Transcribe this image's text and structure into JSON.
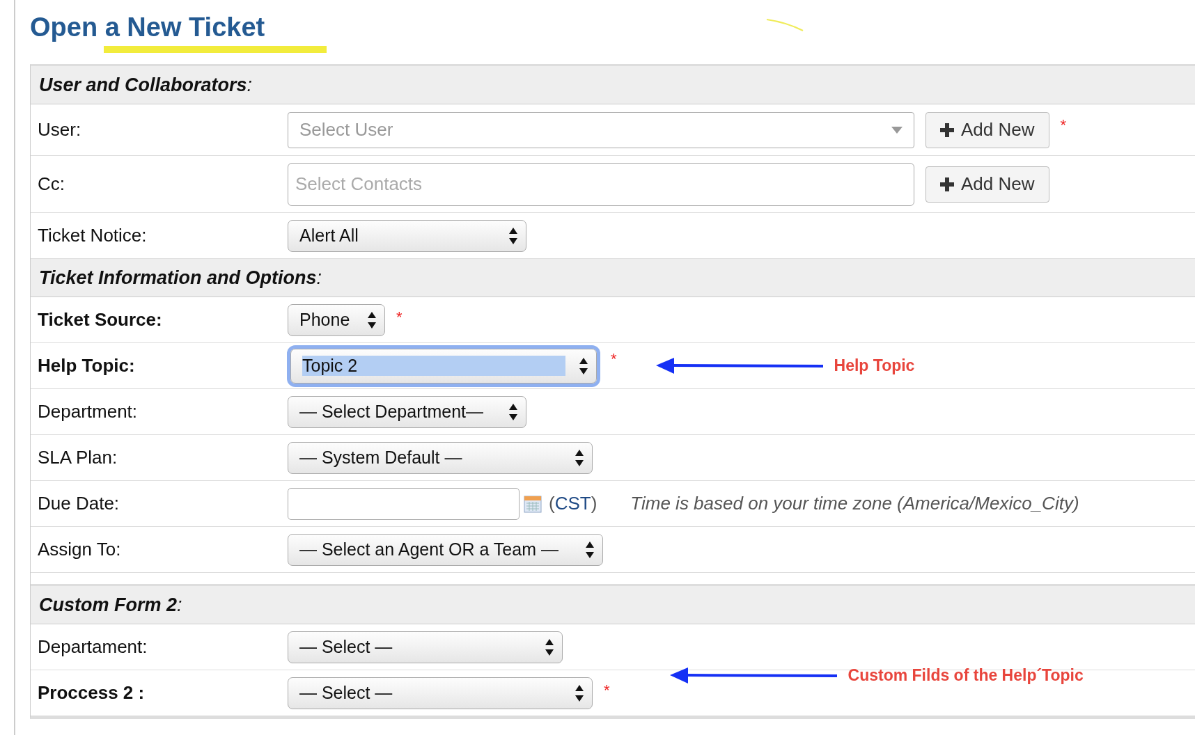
{
  "page": {
    "title": "Open a New Ticket"
  },
  "sections": [
    {
      "title": "**User and Collaborators**:",
      "rows": [
        {
          "kind": "user",
          "label": "User:",
          "bold": false,
          "placeholder": "Select User",
          "button": "Add New",
          "required_mark": "*"
        },
        {
          "kind": "contacts",
          "label": "Cc:",
          "bold": false,
          "placeholder": "Select Contacts",
          "button": "Add New"
        },
        {
          "kind": "select",
          "label": "Ticket Notice:",
          "bold": false,
          "value": "Alert All",
          "focused": false
        }
      ]
    },
    {
      "title": "**Ticket Information and Options**:",
      "rows": [
        {
          "kind": "select",
          "label": "Ticket Source:",
          "bold": true,
          "value": "Phone",
          "focused": false,
          "required_mark": "*"
        },
        {
          "kind": "select",
          "label": "Help Topic:",
          "bold": true,
          "value": "Topic 2",
          "focused": true,
          "required_mark": "*",
          "annotation": "Help Topic"
        },
        {
          "kind": "select",
          "label": "Department:",
          "bold": false,
          "value": "— Select Department—",
          "focused": false
        },
        {
          "kind": "select",
          "label": "SLA Plan:",
          "bold": false,
          "value": "— System Default —",
          "focused": false
        },
        {
          "kind": "date",
          "label": "Due Date:",
          "bold": false,
          "timezone_before": "(",
          "timezone": "CST",
          "timezone_after": ")",
          "note": "Time is based on your time zone (America/Mexico_City)"
        },
        {
          "kind": "select",
          "label": "Assign To:",
          "bold": false,
          "value": "— Select an Agent OR a Team —",
          "focused": false
        }
      ]
    },
    {
      "title": "**Custom Form 2**:",
      "rows": [
        {
          "kind": "select",
          "label": "Departament:",
          "bold": false,
          "value": "— Select —",
          "focused": false
        },
        {
          "kind": "select",
          "label": "Proccess 2 :",
          "bold": true,
          "value": "— Select —",
          "focused": false,
          "required_mark": "*",
          "annotation": "Custom Filds of the Help´Topic"
        }
      ]
    }
  ]
}
